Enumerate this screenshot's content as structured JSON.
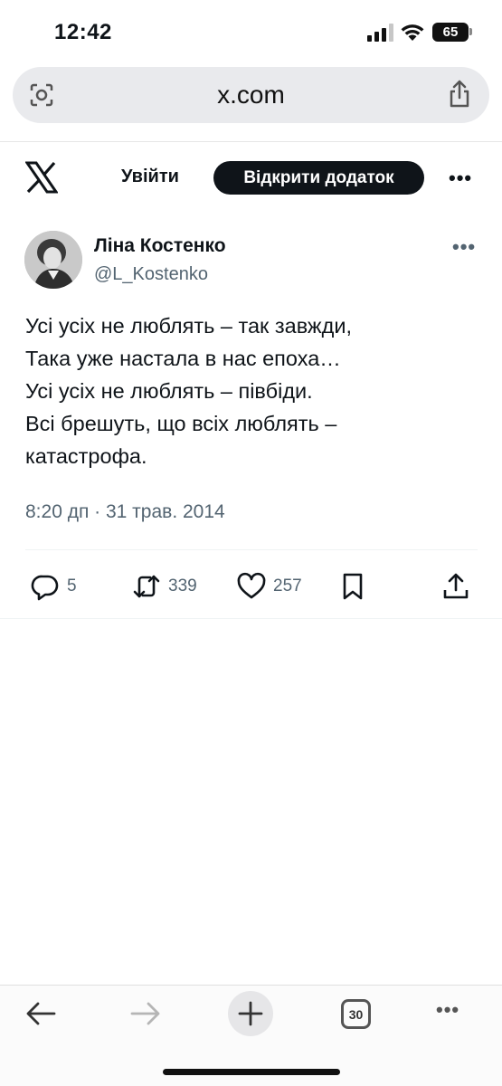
{
  "status_bar": {
    "time": "12:42",
    "battery": "65"
  },
  "browser": {
    "url": "x.com",
    "tabs_count": "30"
  },
  "header": {
    "login_label": "Увійти",
    "open_app_label": "Відкрити додаток",
    "more_label": "•••"
  },
  "tweet": {
    "author_name": "Ліна Костенко",
    "author_handle": "@L_Kostenko",
    "more_label": "•••",
    "lines": [
      "Усі усіх не люблять – так завжди,",
      "Така уже настала в нас епоха…",
      "Усі усіх не люблять – пiвбіди.",
      "Всі брешуть, що всіх люблять –",
      "катастрофа."
    ],
    "meta": "8:20 дп · 31 трав. 2014",
    "replies": "5",
    "retweets": "339",
    "likes": "257"
  },
  "bottom_bar": {
    "more_label": "•••"
  },
  "icons": {
    "x_logo": "x-logo-icon",
    "reply": "reply-icon",
    "retweet": "retweet-icon",
    "like": "heart-icon",
    "bookmark": "bookmark-icon",
    "share": "share-icon"
  },
  "colors": {
    "primary_text": "#0f1419",
    "secondary_text": "#536471",
    "button_bg": "#0f1419"
  }
}
